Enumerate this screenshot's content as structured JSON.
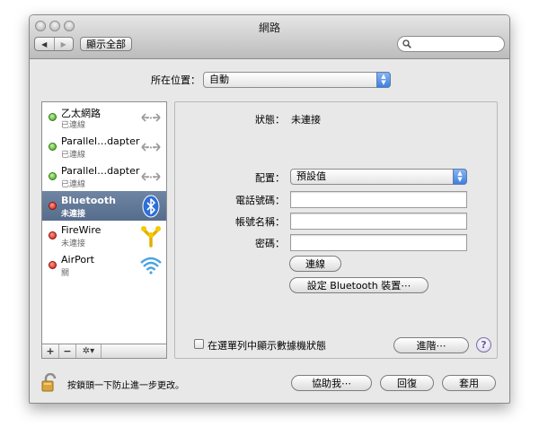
{
  "window": {
    "title": "網路"
  },
  "toolbar": {
    "back": "◀",
    "forward": "▶",
    "show_all": "顯示全部",
    "search_placeholder": ""
  },
  "location": {
    "label": "所在位置：",
    "value": "自動"
  },
  "services": [
    {
      "name": "乙太網路",
      "status": "已連線",
      "dot": "green",
      "icon": "ethernet-arrows-icon",
      "selected": false
    },
    {
      "name": "Parallel…dapter",
      "status": "已連線",
      "dot": "green",
      "icon": "ethernet-arrows-icon",
      "selected": false
    },
    {
      "name": "Parallel…dapter",
      "status": "已連線",
      "dot": "green",
      "icon": "ethernet-arrows-icon",
      "selected": false
    },
    {
      "name": "Bluetooth",
      "status": "未連接",
      "dot": "red",
      "icon": "bluetooth-icon",
      "selected": true
    },
    {
      "name": "FireWire",
      "status": "未連接",
      "dot": "red",
      "icon": "firewire-icon",
      "selected": false
    },
    {
      "name": "AirPort",
      "status": "關",
      "dot": "red",
      "icon": "airport-wifi-icon",
      "selected": false
    }
  ],
  "sidebar_tools": {
    "add": "+",
    "remove": "−",
    "action": "✲▾"
  },
  "detail": {
    "status_label": "狀態：",
    "status_value": "未連接",
    "config_label": "配置：",
    "config_value": "預設值",
    "phone_label": "電話號碼：",
    "phone_value": "",
    "account_label": "帳號名稱：",
    "account_value": "",
    "password_label": "密碼：",
    "password_value": "",
    "connect_button": "連線",
    "setup_button": "設定 Bluetooth 裝置⋯",
    "show_status_checkbox": "在選單列中顯示數據機狀態",
    "show_status_checked": false,
    "advanced_button": "進階⋯",
    "help": "?"
  },
  "footer": {
    "lock_text": "按鎖頭一下防止進一步更改。",
    "assist_button": "協助我⋯",
    "revert_button": "回復",
    "apply_button": "套用"
  },
  "colors": {
    "selection": "#5d7396",
    "green_dot": "#3b9a1c",
    "red_dot": "#c9170c",
    "bluetooth": "#2e6fd8"
  }
}
